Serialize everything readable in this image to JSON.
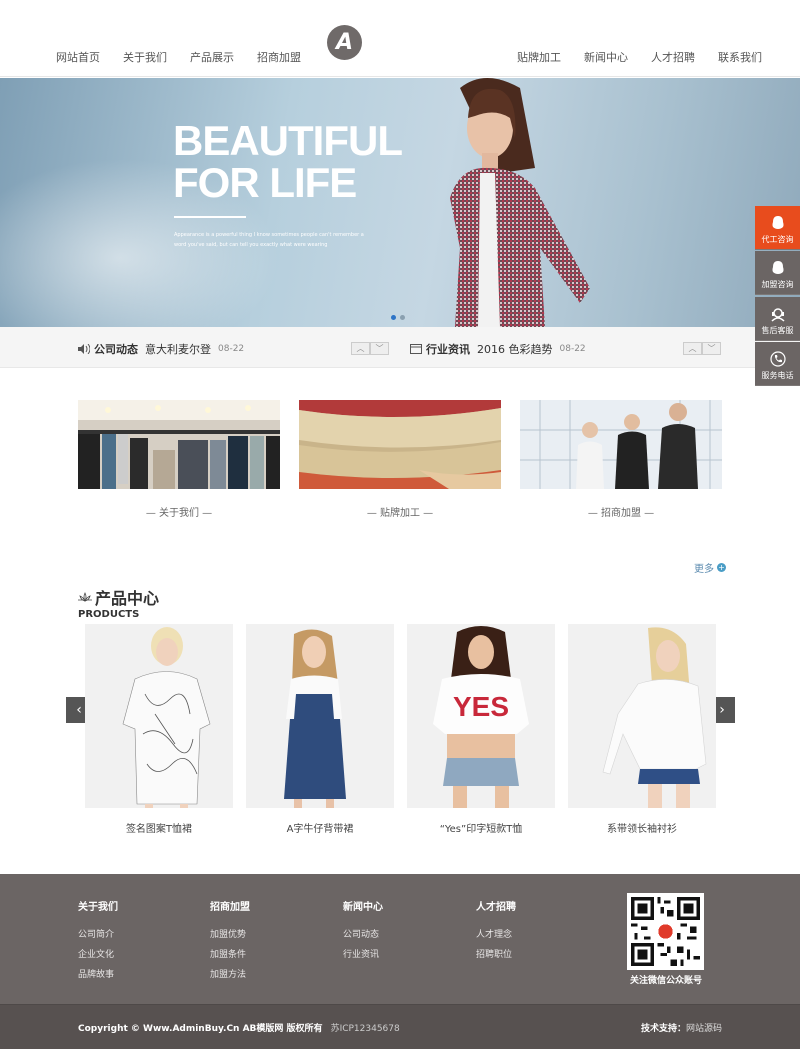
{
  "nav": {
    "left": [
      "网站首页",
      "关于我们",
      "产品展示",
      "招商加盟"
    ],
    "right": [
      "贴牌加工",
      "新闻中心",
      "人才招聘",
      "联系我们"
    ],
    "logo_letter": "A"
  },
  "banner": {
    "title_line1": "BEAUTIFUL",
    "title_line2": "FOR LIFE",
    "subtitle": "Appearance is a powerful thing I know sometimes people can't remember a word you've said, but can tell you exactly what were wearing",
    "slides_total": 2,
    "active_slide": 1
  },
  "newsbar": {
    "left": {
      "title": "公司动态",
      "text": "意大利麦尔登",
      "date": "08-22"
    },
    "right": {
      "title": "行业资讯",
      "text": "2016 色彩趋势",
      "date": "08-22"
    },
    "prev_arrow": "︿",
    "next_arrow": "﹀"
  },
  "intro": [
    {
      "caption": "— 关于我们 —"
    },
    {
      "caption": "— 贴牌加工 —"
    },
    {
      "caption": "— 招商加盟 —"
    }
  ],
  "products": {
    "more_label": "更多",
    "title": "产品中心",
    "subtitle": "PRODUCTS",
    "items": [
      {
        "name": "签名图案T恤裙"
      },
      {
        "name": "A字牛仔背带裙"
      },
      {
        "name": "“Yes”印字短款T恤"
      },
      {
        "name": "系带领长袖衬衫"
      }
    ],
    "prev": "‹",
    "next": "›"
  },
  "footer": {
    "cols": [
      {
        "title": "关于我们",
        "links": [
          "公司简介",
          "企业文化",
          "品牌故事"
        ]
      },
      {
        "title": "招商加盟",
        "links": [
          "加盟优势",
          "加盟条件",
          "加盟方法"
        ]
      },
      {
        "title": "新闻中心",
        "links": [
          "公司动态",
          "行业资讯"
        ]
      },
      {
        "title": "人才招聘",
        "links": [
          "人才理念",
          "招聘职位"
        ]
      }
    ],
    "qr_caption": "关注微信公众账号",
    "copyright": "Copyright © Www.AdminBuy.Cn AB模版网 版权所有",
    "icp": "苏ICP12345678",
    "support_label": "技术支持：",
    "support_link": "网站源码"
  },
  "side": [
    {
      "label": "代工咨询"
    },
    {
      "label": "加盟咨询"
    },
    {
      "label": "售后客服"
    },
    {
      "label": "服务电话"
    }
  ],
  "colors": {
    "accent_red": "#e84c1d",
    "footer_bg": "#6b6564",
    "active_dot": "#2d74c6"
  }
}
